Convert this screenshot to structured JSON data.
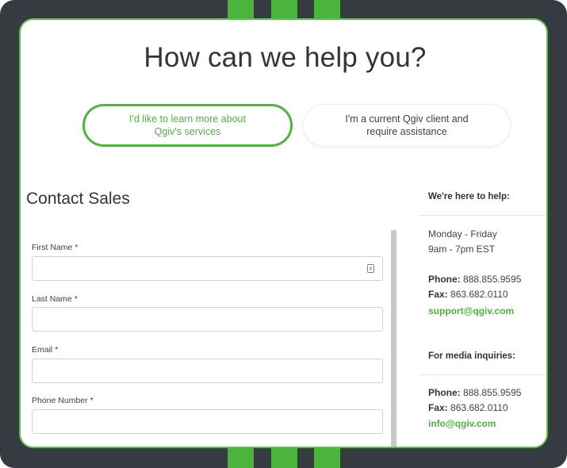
{
  "heading": "How can we help you?",
  "choices": {
    "learn_more": {
      "line1": "I'd like to learn more about",
      "line2": "Qgiv's services"
    },
    "current_client": {
      "line1": "I'm a current Qgiv client and",
      "line2": "require assistance"
    }
  },
  "form": {
    "title": "Contact Sales",
    "fields": [
      {
        "label": "First Name *",
        "value": ""
      },
      {
        "label": "Last Name *",
        "value": ""
      },
      {
        "label": "Email *",
        "value": ""
      },
      {
        "label": "Phone Number *",
        "value": ""
      }
    ]
  },
  "sidebar": {
    "help_heading": "We're here to help:",
    "hours_days": "Monday - Friday",
    "hours_times": "9am - 7pm EST",
    "support": {
      "phone_label": "Phone:",
      "phone": "888.855.9595",
      "fax_label": "Fax:",
      "fax": "863.682.0110",
      "email": "support@qgiv.com"
    },
    "media_heading": "For media inquiries:",
    "media": {
      "phone_label": "Phone:",
      "phone": "888.855.9595",
      "fax_label": "Fax:",
      "fax": "863.682.0110",
      "email": "info@qgiv.com"
    }
  },
  "colors": {
    "brand_green": "#4bb43c",
    "frame_dark": "#353b40"
  },
  "icons": {
    "first_name_field": "contact-card-icon"
  }
}
